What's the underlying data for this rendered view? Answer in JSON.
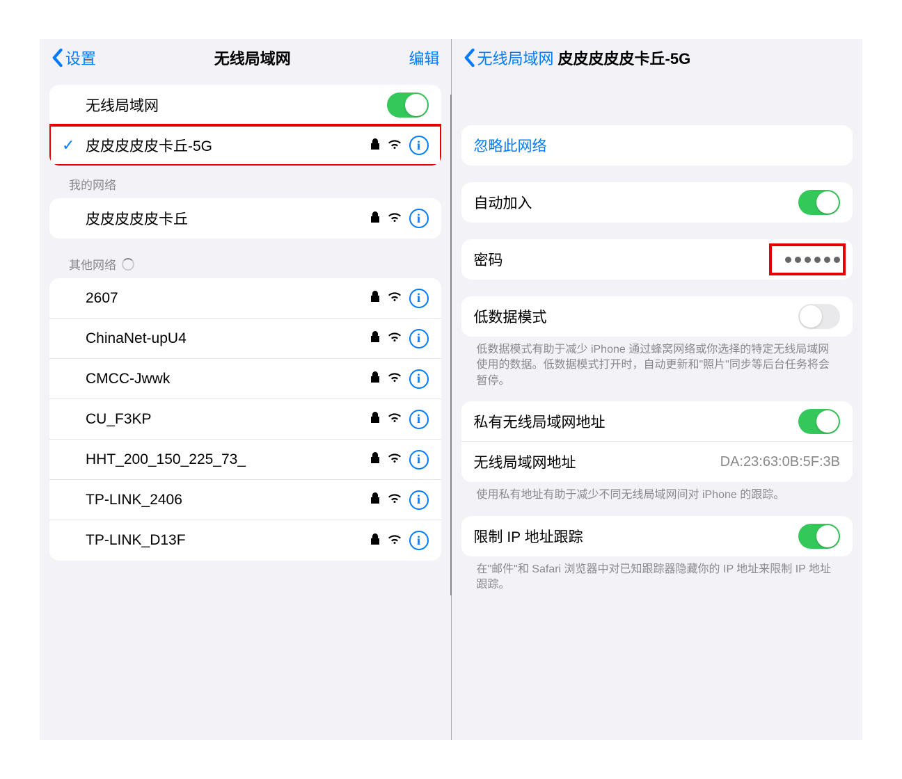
{
  "left": {
    "back": "设置",
    "title": "无线局域网",
    "edit": "编辑",
    "wifi_toggle_label": "无线局域网",
    "connected_network": "皮皮皮皮皮卡丘-5G",
    "my_networks_header": "我的网络",
    "my_networks": [
      {
        "name": "皮皮皮皮皮卡丘"
      }
    ],
    "other_networks_header": "其他网络",
    "other_networks": [
      {
        "name": "2607"
      },
      {
        "name": "ChinaNet-upU4"
      },
      {
        "name": "CMCC-Jwwk"
      },
      {
        "name": "CU_F3KP"
      },
      {
        "name": "HHT_200_150_225_73_"
      },
      {
        "name": "TP-LINK_2406"
      },
      {
        "name": "TP-LINK_D13F"
      }
    ]
  },
  "right": {
    "back": "无线局域网",
    "title": "皮皮皮皮皮卡丘-5G",
    "forget": "忽略此网络",
    "auto_join": "自动加入",
    "password_label": "密码",
    "low_data_label": "低数据模式",
    "low_data_footer": "低数据模式有助于减少 iPhone 通过蜂窝网络或你选择的特定无线局域网使用的数据。低数据模式打开时，自动更新和\"照片\"同步等后台任务将会暂停。",
    "private_addr_label": "私有无线局域网地址",
    "wlan_addr_label": "无线局域网地址",
    "wlan_addr_value": "DA:23:63:0B:5F:3B",
    "private_footer": "使用私有地址有助于减少不同无线局域网间对 iPhone 的跟踪。",
    "limit_ip_label": "限制 IP 地址跟踪",
    "limit_ip_footer": "在\"邮件\"和 Safari 浏览器中对已知跟踪器隐藏你的 IP 地址来限制 IP 地址跟踪。"
  }
}
